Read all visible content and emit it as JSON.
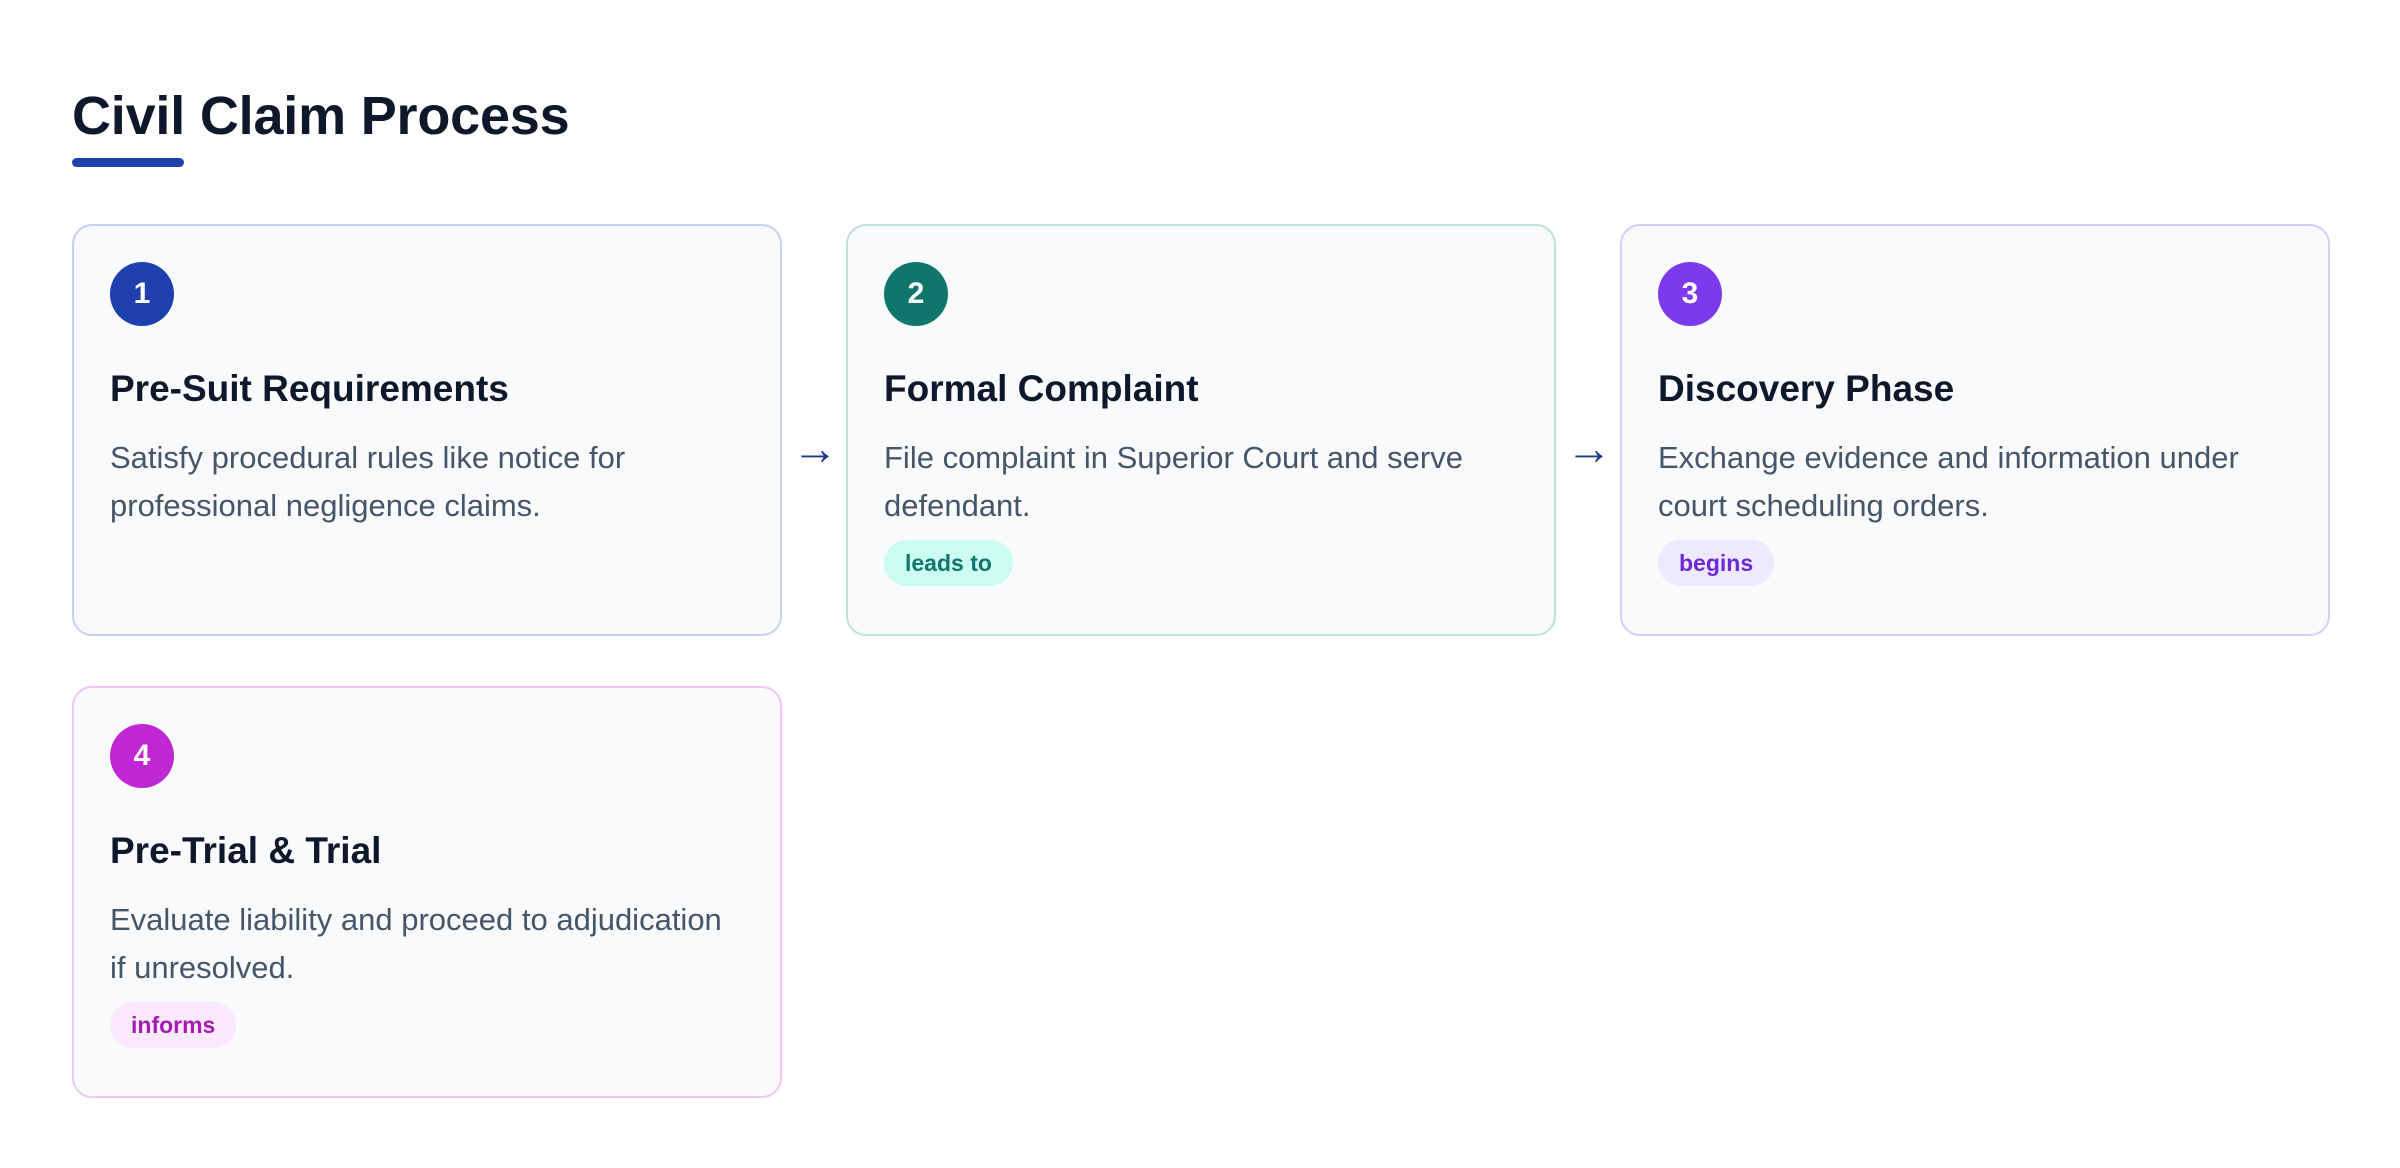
{
  "title": "Civil Claim Process",
  "colors": {
    "title_accent": "#1e40af",
    "connector_arrow": "#1e3a8a"
  },
  "connectors": [
    {
      "glyph": "→",
      "from": "1",
      "to": "2"
    },
    {
      "glyph": "→",
      "from": "2",
      "to": "3"
    }
  ],
  "steps": [
    {
      "number": "1",
      "title": "Pre-Suit Requirements",
      "description": "Satisfy procedural rules like notice for professional negligence claims.",
      "tag": "",
      "color": "#1e40af",
      "tag_bg": "",
      "tag_fg": ""
    },
    {
      "number": "2",
      "title": "Formal Complaint",
      "description": "File complaint in Superior Court and serve defendant.",
      "tag": "leads to",
      "color": "#0f766e",
      "tag_bg": "#ccfbf1",
      "tag_fg": "#0f766e"
    },
    {
      "number": "3",
      "title": "Discovery Phase",
      "description": "Exchange evidence and information under court scheduling orders.",
      "tag": "begins",
      "color": "#7c3aed",
      "tag_bg": "#ede9fe",
      "tag_fg": "#6d28d9"
    },
    {
      "number": "4",
      "title": "Pre-Trial & Trial",
      "description": "Evaluate liability and proceed to adjudication if unresolved.",
      "tag": "informs",
      "color": "#c026d3",
      "tag_bg": "#fae8ff",
      "tag_fg": "#a21caf"
    }
  ]
}
